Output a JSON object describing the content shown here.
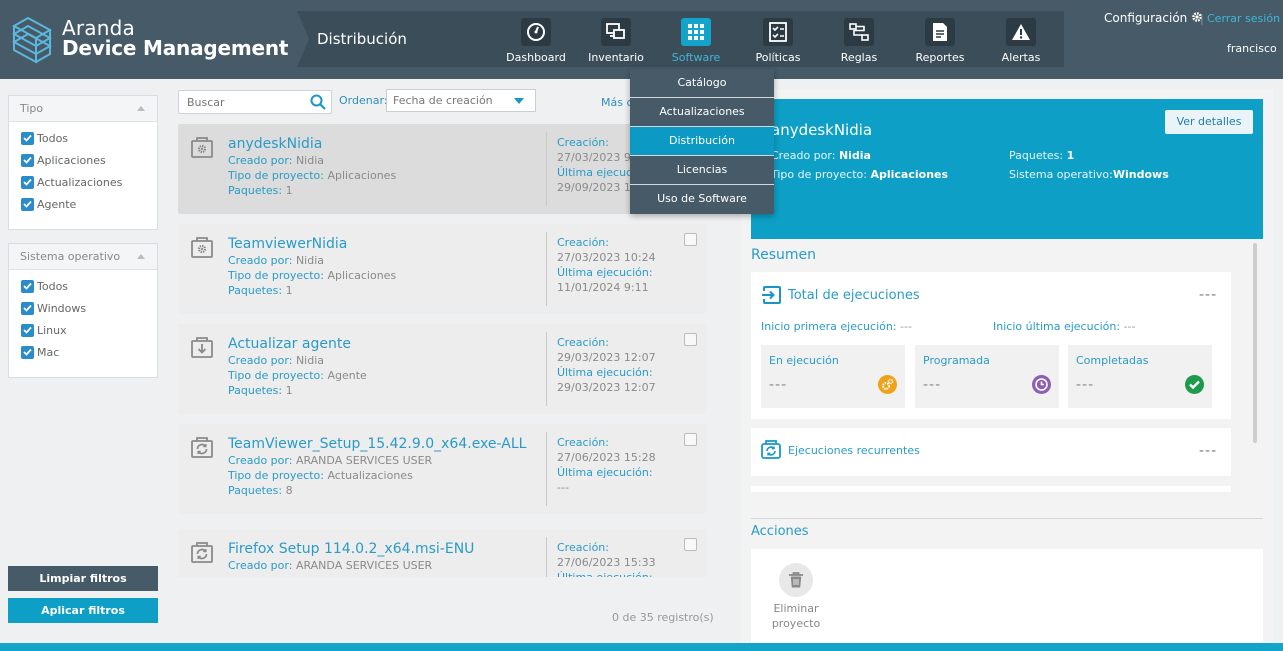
{
  "brand": {
    "line1": "Aranda",
    "line2": "Device Management"
  },
  "header": {
    "section_title": "Distribución",
    "config_label": "Configuración",
    "separator": "|",
    "logout_label": "Cerrar sesión",
    "username": "francisco"
  },
  "nav": [
    {
      "label": "Dashboard",
      "icon": "dashboard-icon"
    },
    {
      "label": "Inventario",
      "icon": "inventory-icon"
    },
    {
      "label": "Software",
      "icon": "grid-icon",
      "active": true
    },
    {
      "label": "Políticas",
      "icon": "checklist-icon"
    },
    {
      "label": "Reglas",
      "icon": "rules-icon"
    },
    {
      "label": "Reportes",
      "icon": "report-icon"
    },
    {
      "label": "Alertas",
      "icon": "alert-icon"
    }
  ],
  "software_menu": [
    "Catálogo",
    "Actualizaciones",
    "Distribución",
    "Licencias",
    "Uso de Software"
  ],
  "filters": {
    "tipo": {
      "title": "Tipo",
      "items": [
        "Todos",
        "Aplicaciones",
        "Actualizaciones",
        "Agente"
      ]
    },
    "so": {
      "title": "Sistema operativo",
      "items": [
        "Todos",
        "Windows",
        "Linux",
        "Mac"
      ]
    },
    "clear_label": "Limpiar filtros",
    "apply_label": "Aplicar filtros"
  },
  "toolbar": {
    "search_placeholder": "Buscar",
    "sort_label": "Ordenar:",
    "sort_value": "Fecha de creación",
    "more_label": "Más c"
  },
  "labels": {
    "created_by": "Creado por:",
    "project_type": "Tipo de proyecto:",
    "packages": "Paquetes:",
    "creation": "Creación:",
    "last_run": "Última ejecución:"
  },
  "projects": [
    {
      "title": "anydeskNidia",
      "created_by": "Nidia",
      "type": "Aplicaciones",
      "packages": "1",
      "creation": "27/03/2023 9:",
      "last_run": "29/09/2023 10:",
      "icon": "gear-icon"
    },
    {
      "title": "TeamviewerNidia",
      "created_by": "Nidia",
      "type": "Aplicaciones",
      "packages": "1",
      "creation": "27/03/2023 10:24",
      "last_run": "11/01/2024 9:11",
      "icon": "gear-icon"
    },
    {
      "title": "Actualizar agente",
      "created_by": "Nidia",
      "type": "Agente",
      "packages": "1",
      "creation": "29/03/2023 12:07",
      "last_run": "29/03/2023 12:07",
      "icon": "download-icon"
    },
    {
      "title": "TeamViewer_Setup_15.42.9.0_x64.exe-ALL",
      "created_by": "ARANDA SERVICES USER",
      "type": "Actualizaciones",
      "packages": "8",
      "creation": "27/06/2023 15:28",
      "last_run": "---",
      "icon": "sync-icon"
    },
    {
      "title": "Firefox Setup 114.0.2_x64.msi-ENU",
      "created_by": "ARANDA SERVICES USER",
      "type": "",
      "packages": "",
      "creation": "27/06/2023 15:33",
      "last_run": "",
      "icon": "sync-icon"
    }
  ],
  "records": "0 de 35 registro(s)",
  "detail": {
    "title": "anydeskNidia",
    "view_button": "Ver detalles",
    "created_by_label": "Creado por:",
    "created_by": "Nidia",
    "type_label": "Tipo de proyecto:",
    "type": "Aplicaciones",
    "packages_label": "Paquetes:",
    "packages": "1",
    "os_label": "Sistema operativo:",
    "os": "Windows"
  },
  "summary": {
    "title": "Resumen",
    "total_label": "Total de ejecuciones",
    "total_value": "---",
    "first_run_label": "Inicio primera ejecución:",
    "first_run": "---",
    "last_run_label": "Inicio última ejecución:",
    "last_run": "---",
    "states": [
      {
        "label": "En ejecución",
        "value": "---",
        "color": "#f0a31a",
        "icon": "running-icon"
      },
      {
        "label": "Programada",
        "value": "---",
        "color": "#8e5db8",
        "icon": "clock-icon"
      },
      {
        "label": "Completadas",
        "value": "---",
        "color": "#1d9a4b",
        "icon": "check-icon"
      }
    ],
    "recurring_label": "Ejecuciones recurrentes",
    "recurring_value": "---"
  },
  "actions": {
    "title": "Acciones",
    "delete_label": "Eliminar proyecto"
  },
  "colors": {
    "header": "#465a68",
    "accent": "#12a4c9",
    "button_dark": "#465a68",
    "button_apply": "#0d9fc5"
  }
}
